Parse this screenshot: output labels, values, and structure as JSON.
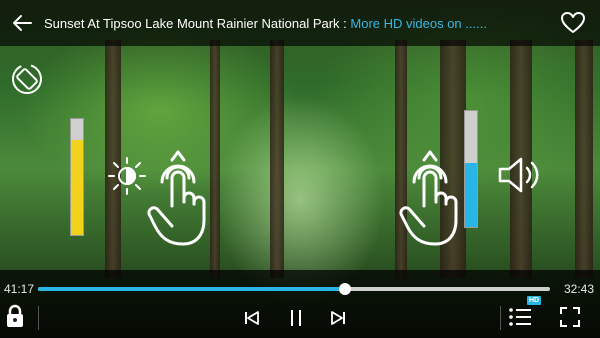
{
  "header": {
    "title": "Sunset At Tipsoo Lake Mount Rainier National Park : ",
    "more_link": "More HD videos on ......"
  },
  "overlays": {
    "brightness_level": 0.82,
    "volume_level": 0.55
  },
  "playback": {
    "current_time": "41:17",
    "total_time": "32:43",
    "progress": 0.6
  },
  "badges": {
    "hd": "HD"
  },
  "colors": {
    "accent": "#29b6e6",
    "brightness": "#f2d21c",
    "volume": "#29b6e6"
  },
  "icons": [
    "back-arrow-icon",
    "heart-icon",
    "rotate-screen-icon",
    "brightness-icon",
    "swipe-up-hand-icon",
    "volume-icon",
    "lock-icon",
    "previous-icon",
    "pause-icon",
    "next-icon",
    "playlist-icon",
    "fullscreen-icon"
  ]
}
